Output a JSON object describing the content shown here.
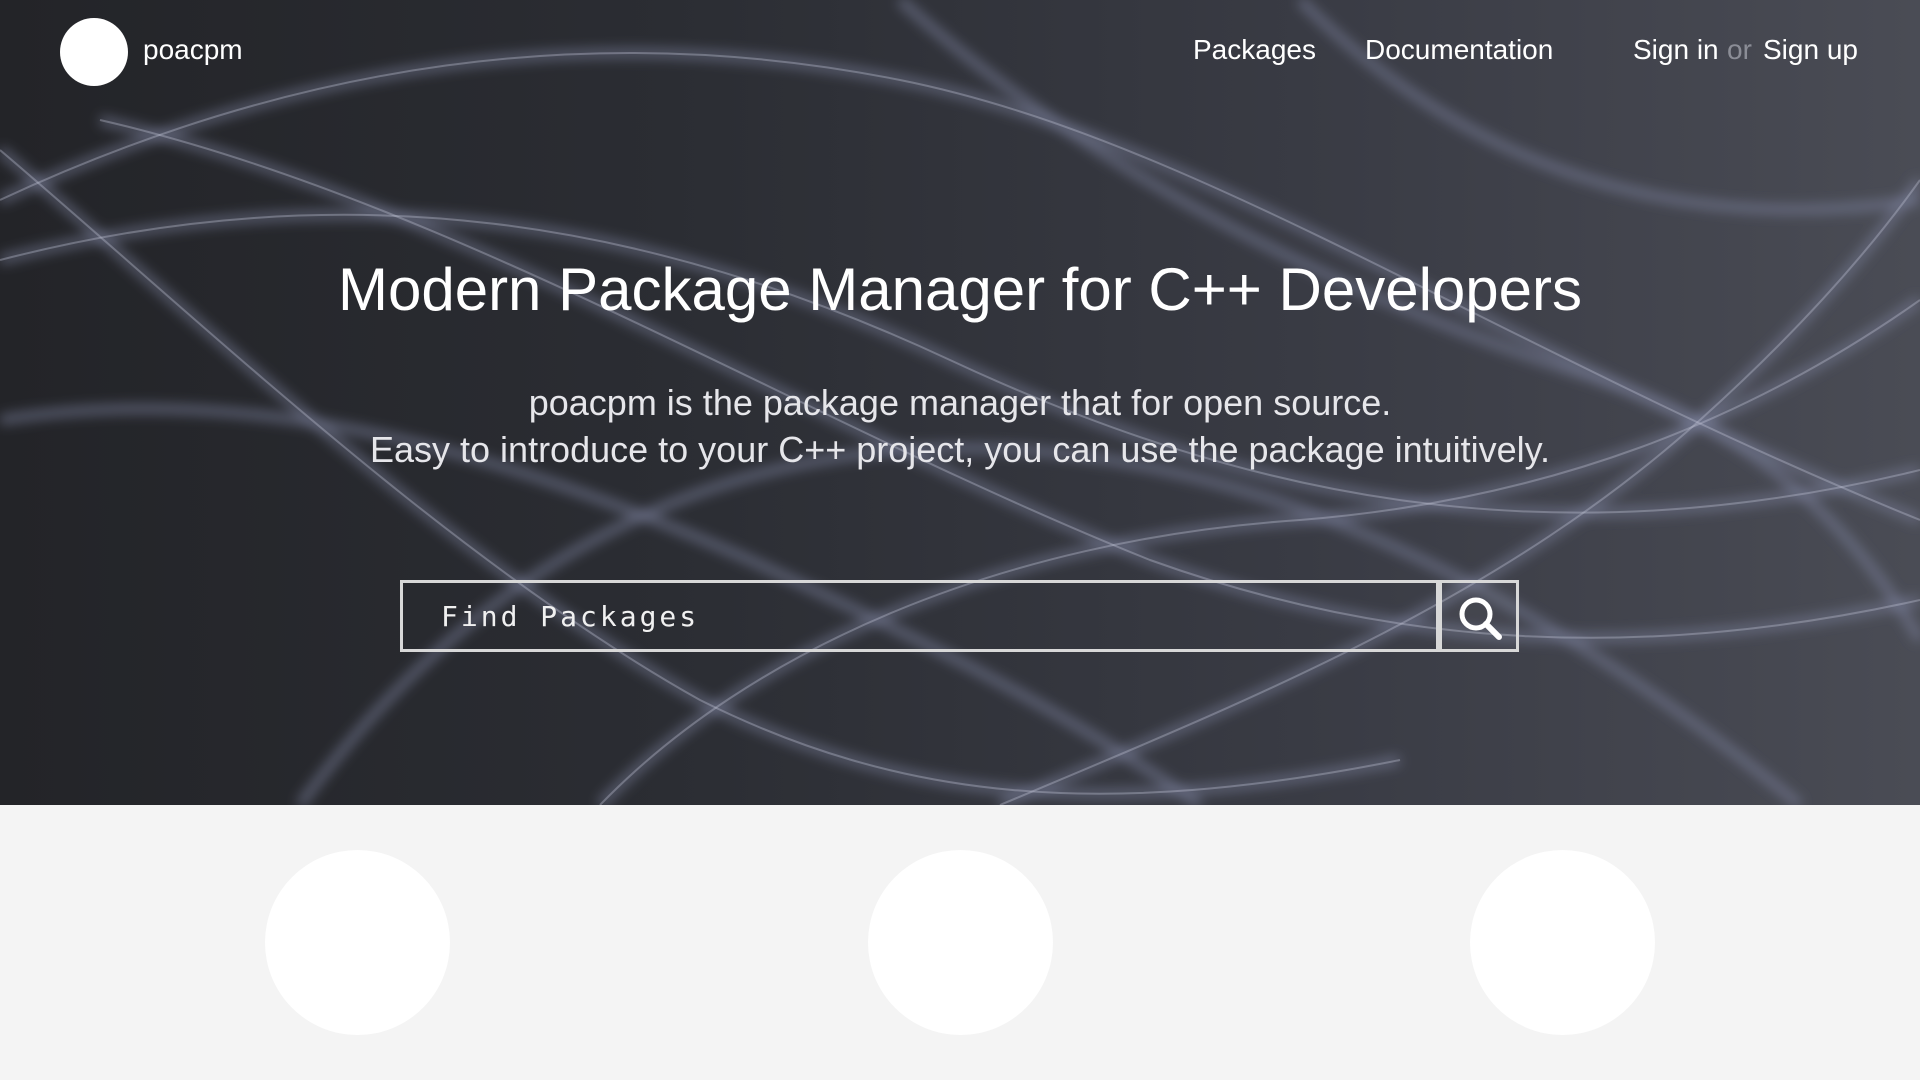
{
  "navbar": {
    "brand": "poacpm",
    "links": {
      "packages": "Packages",
      "documentation": "Documentation",
      "sign_in": "Sign in",
      "or": "or",
      "sign_up": "Sign up"
    }
  },
  "hero": {
    "title": "Modern Package Manager for C++ Developers",
    "subtitle_line1": "poacpm is the package manager that for open source.",
    "subtitle_line2": "Easy to introduce to your C++ project, you can use the package intuitively."
  },
  "search": {
    "placeholder": "Find Packages",
    "button_icon": "search-icon"
  },
  "colors": {
    "hero_dark": "#232428",
    "hero_light": "#4a4c55",
    "lower_bg": "#f4f4f4",
    "text": "#ffffff",
    "muted": "#8b8d96"
  }
}
